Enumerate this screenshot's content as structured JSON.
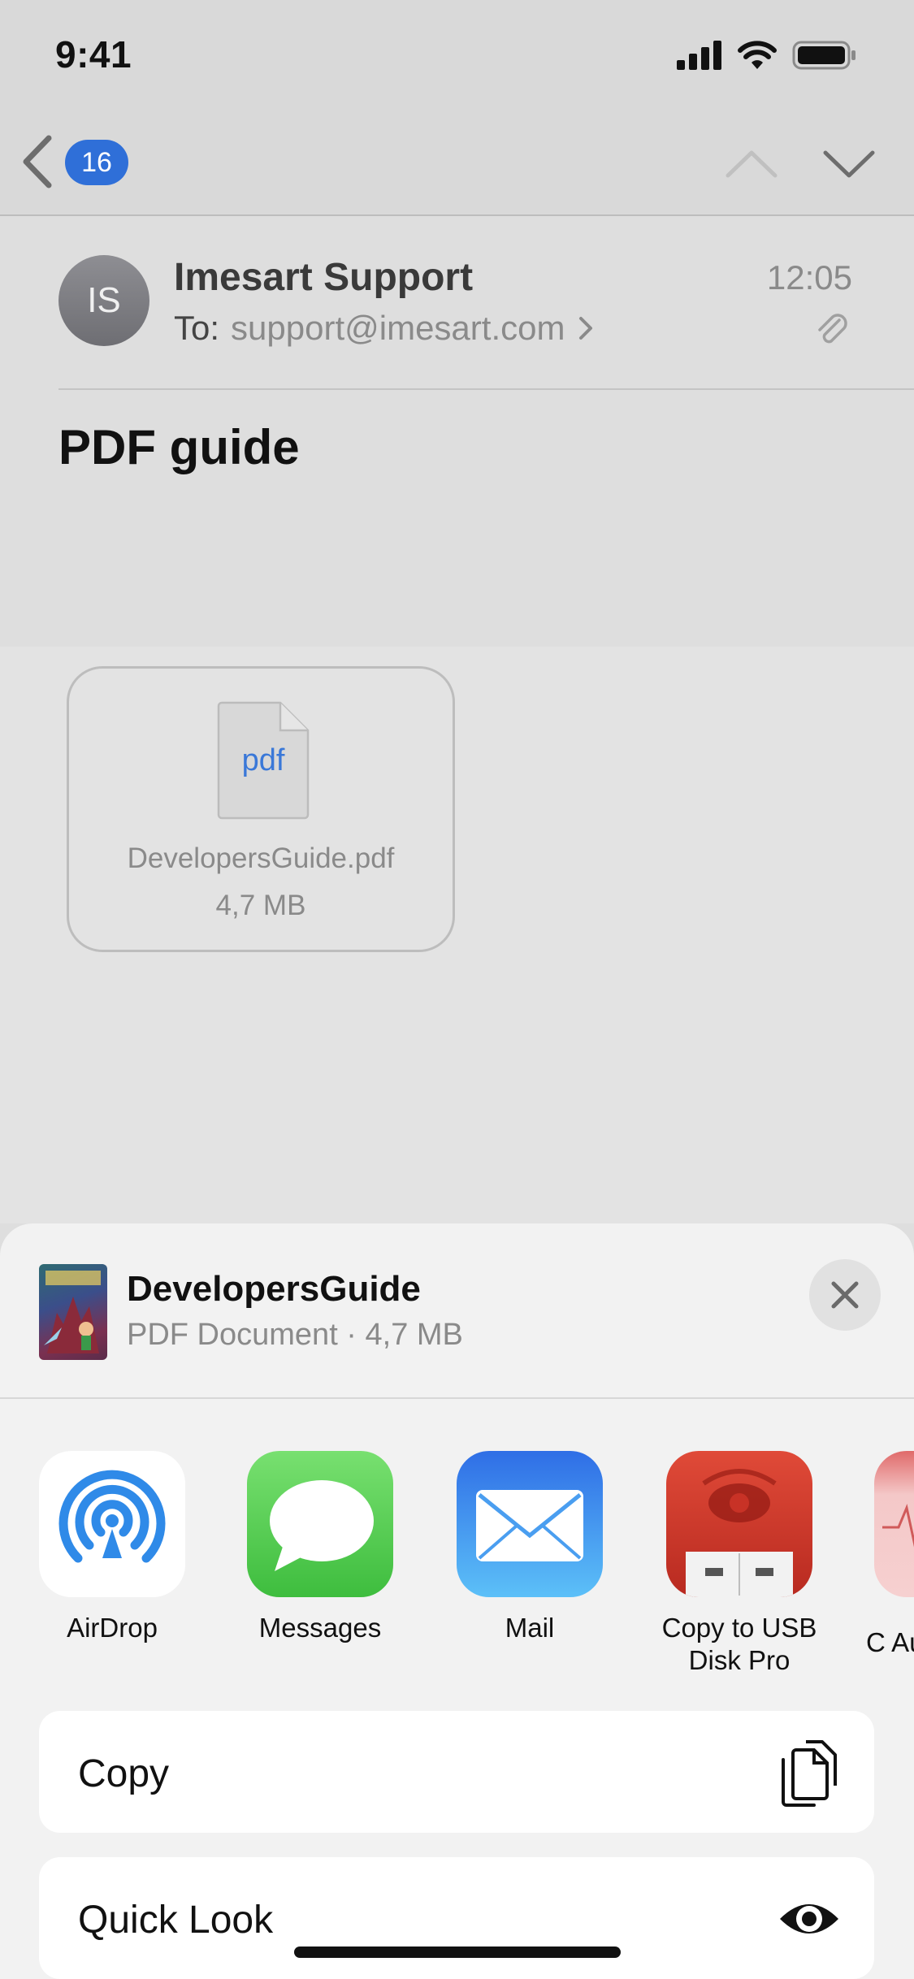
{
  "status_bar": {
    "time": "9:41"
  },
  "nav": {
    "badge_count": "16"
  },
  "email": {
    "avatar_initials": "IS",
    "sender": "Imesart Support",
    "to_label": "To:",
    "to_address": "support@imesart.com",
    "time": "12:05",
    "subject": "PDF guide"
  },
  "attachment": {
    "type_label": "pdf",
    "file_name": "DevelopersGuide.pdf",
    "file_size": "4,7 MB"
  },
  "share_sheet": {
    "title": "DevelopersGuide",
    "subtitle": "PDF Document · 4,7 MB",
    "apps": [
      {
        "label": "AirDrop"
      },
      {
        "label": "Messages"
      },
      {
        "label": "Mail"
      },
      {
        "label": "Copy to USB Disk Pro"
      },
      {
        "label": "C Aud"
      }
    ],
    "actions": [
      {
        "label": "Copy",
        "icon": "copy-icon"
      },
      {
        "label": "Quick Look",
        "icon": "eye-icon"
      }
    ]
  },
  "colors": {
    "accent_blue": "#2f6fd8",
    "messages_green": "#5bcf5b",
    "mail_blue": "#3b8cf0",
    "usb_red": "#d23a2a"
  }
}
